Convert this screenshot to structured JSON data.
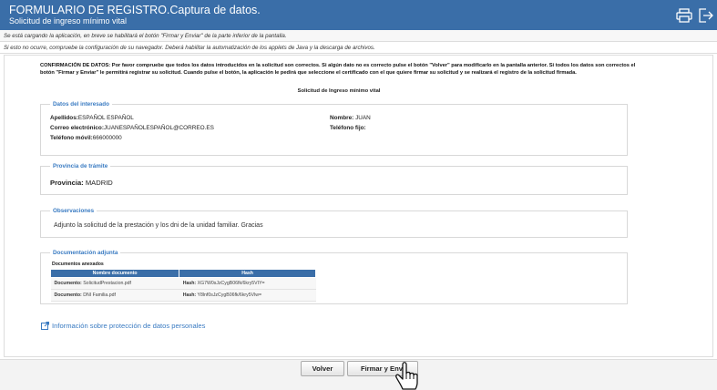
{
  "header": {
    "title": "FORMULARIO DE REGISTRO.Captura de datos.",
    "subtitle": "Solicitud de ingreso mínimo vital",
    "actions": [
      {
        "icon": "printer-icon"
      },
      {
        "icon": "exit-icon"
      }
    ]
  },
  "notices": [
    "Se está cargando la aplicación, en breve se habilitará el botón \"Firmar y Enviar\" de la parte inferior de la pantalla.",
    "Si esto no ocurre, compruebe la configuración de su navegador. Deberá habilitar la automatización de los applets de Java y la descarga de archivos."
  ],
  "confirmation": "CONFIRMACIÓN DE DATOS: Por favor compruebe que todos los datos introducidos en la solicitud son correctos. Si algún dato no es correcto pulse el botón \"Volver\" para modificarlo en la pantalla anterior. Si todos los datos son correctos el botón \"Firmar y Enviar\" le permitirá registrar su solicitud. Cuando pulse el botón, la aplicación le pedirá que seleccione el certificado con el que quiere firmar su solicitud y se realizará el registro de la solicitud firmada.",
  "form_title": "Solicitud de Ingreso mínimo vital",
  "datos": {
    "legend": "Datos del interesado",
    "apellidos_label": "Apellidos:",
    "apellidos_value": "ESPAÑOL ESPAÑOL",
    "nombre_label": "Nombre:",
    "nombre_value": "JUAN",
    "email_label": "Correo electrónico:",
    "email_value": "JUANESPAÑOLESPAÑOL@CORREO.ES",
    "fijo_label": "Teléfono fijo:",
    "fijo_value": "",
    "movil_label": "Teléfono móvil:",
    "movil_value": "666000000"
  },
  "provincia": {
    "legend": "Provincia de trámite",
    "label": "Provincia:",
    "value": "MADRID"
  },
  "observaciones": {
    "legend": "Observaciones",
    "value": "Adjunto la solicitud de la prestación y los dni de la unidad familiar. Gracias"
  },
  "documentacion": {
    "legend": "Documentación adjunta",
    "caption": "Documentos anexados",
    "headers": [
      "Nombre documento",
      "Hash"
    ],
    "rows": [
      {
        "doc_label": "Documento:",
        "doc_value": "SolicitudPrestacion.pdf",
        "hash_label": "Hash:",
        "hash_value": "XG7W0sJzCygB06fk/6kry5VIY="
      },
      {
        "doc_label": "Documento:",
        "doc_value": "DNI Familia.pdf",
        "hash_label": "Hash:",
        "hash_value": "Y8lnf0sJzCygB06fk/6kry5Vlw="
      }
    ]
  },
  "privacy_link": "Información sobre protección de datos personales",
  "buttons": {
    "volver": "Volver",
    "firmar": "Firmar y Envi"
  },
  "colors": {
    "header_bg": "#3a6ea8",
    "legend": "#3a7bc2"
  }
}
